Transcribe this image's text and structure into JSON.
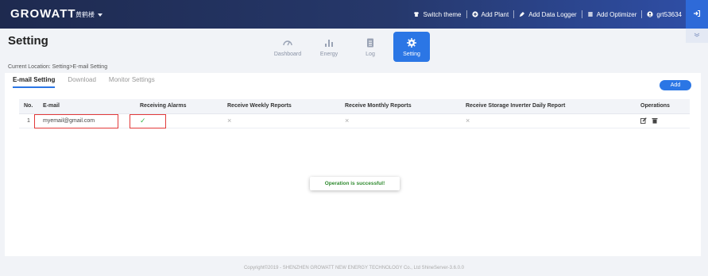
{
  "topbar": {
    "logo": "GROWATT",
    "plant_name": "黄鹤楼",
    "nav": [
      {
        "label": "Switch theme",
        "icon": "shirt-icon"
      },
      {
        "label": "Add Plant",
        "icon": "plus-circle-icon"
      },
      {
        "label": "Add Data Logger",
        "icon": "plug-icon"
      },
      {
        "label": "Add Optimizer",
        "icon": "optimizer-icon"
      },
      {
        "label": "grt53634",
        "icon": "user-icon"
      }
    ]
  },
  "page": {
    "title": "Setting",
    "breadcrumb": "Current Location: Setting>E-mail Setting"
  },
  "modules": [
    {
      "label": "Dashboard",
      "icon": "gauge-icon",
      "active": false
    },
    {
      "label": "Energy",
      "icon": "bar-chart-icon",
      "active": false
    },
    {
      "label": "Log",
      "icon": "log-icon",
      "active": false
    },
    {
      "label": "Setting",
      "icon": "gear-icon",
      "active": true
    }
  ],
  "subtabs": [
    "E-mail Setting",
    "Download",
    "Monitor Settings"
  ],
  "add_button": "Add",
  "table": {
    "headers": [
      "No.",
      "E-mail",
      "Receiving Alarms",
      "Receive Weekly Reports",
      "Receive Monthly Reports",
      "Receive Storage Inverter Daily Report",
      "Operations"
    ],
    "rows": [
      {
        "no": "1",
        "email": "myemail@gmail.com",
        "alarms": "✓",
        "weekly": "×",
        "monthly": "×",
        "storage": "×"
      }
    ]
  },
  "toast": "Operation is successful!",
  "footer": "Copyright©2019 - SHENZHEN GROWATT NEW ENERGY TECHNOLOGY Co., Ltd ShineServer-3.6.0.0",
  "colors": {
    "accent": "#2b76e5",
    "topbar": "#1e2a4f",
    "success": "#39b54a",
    "highlight": "#e23a3a"
  }
}
